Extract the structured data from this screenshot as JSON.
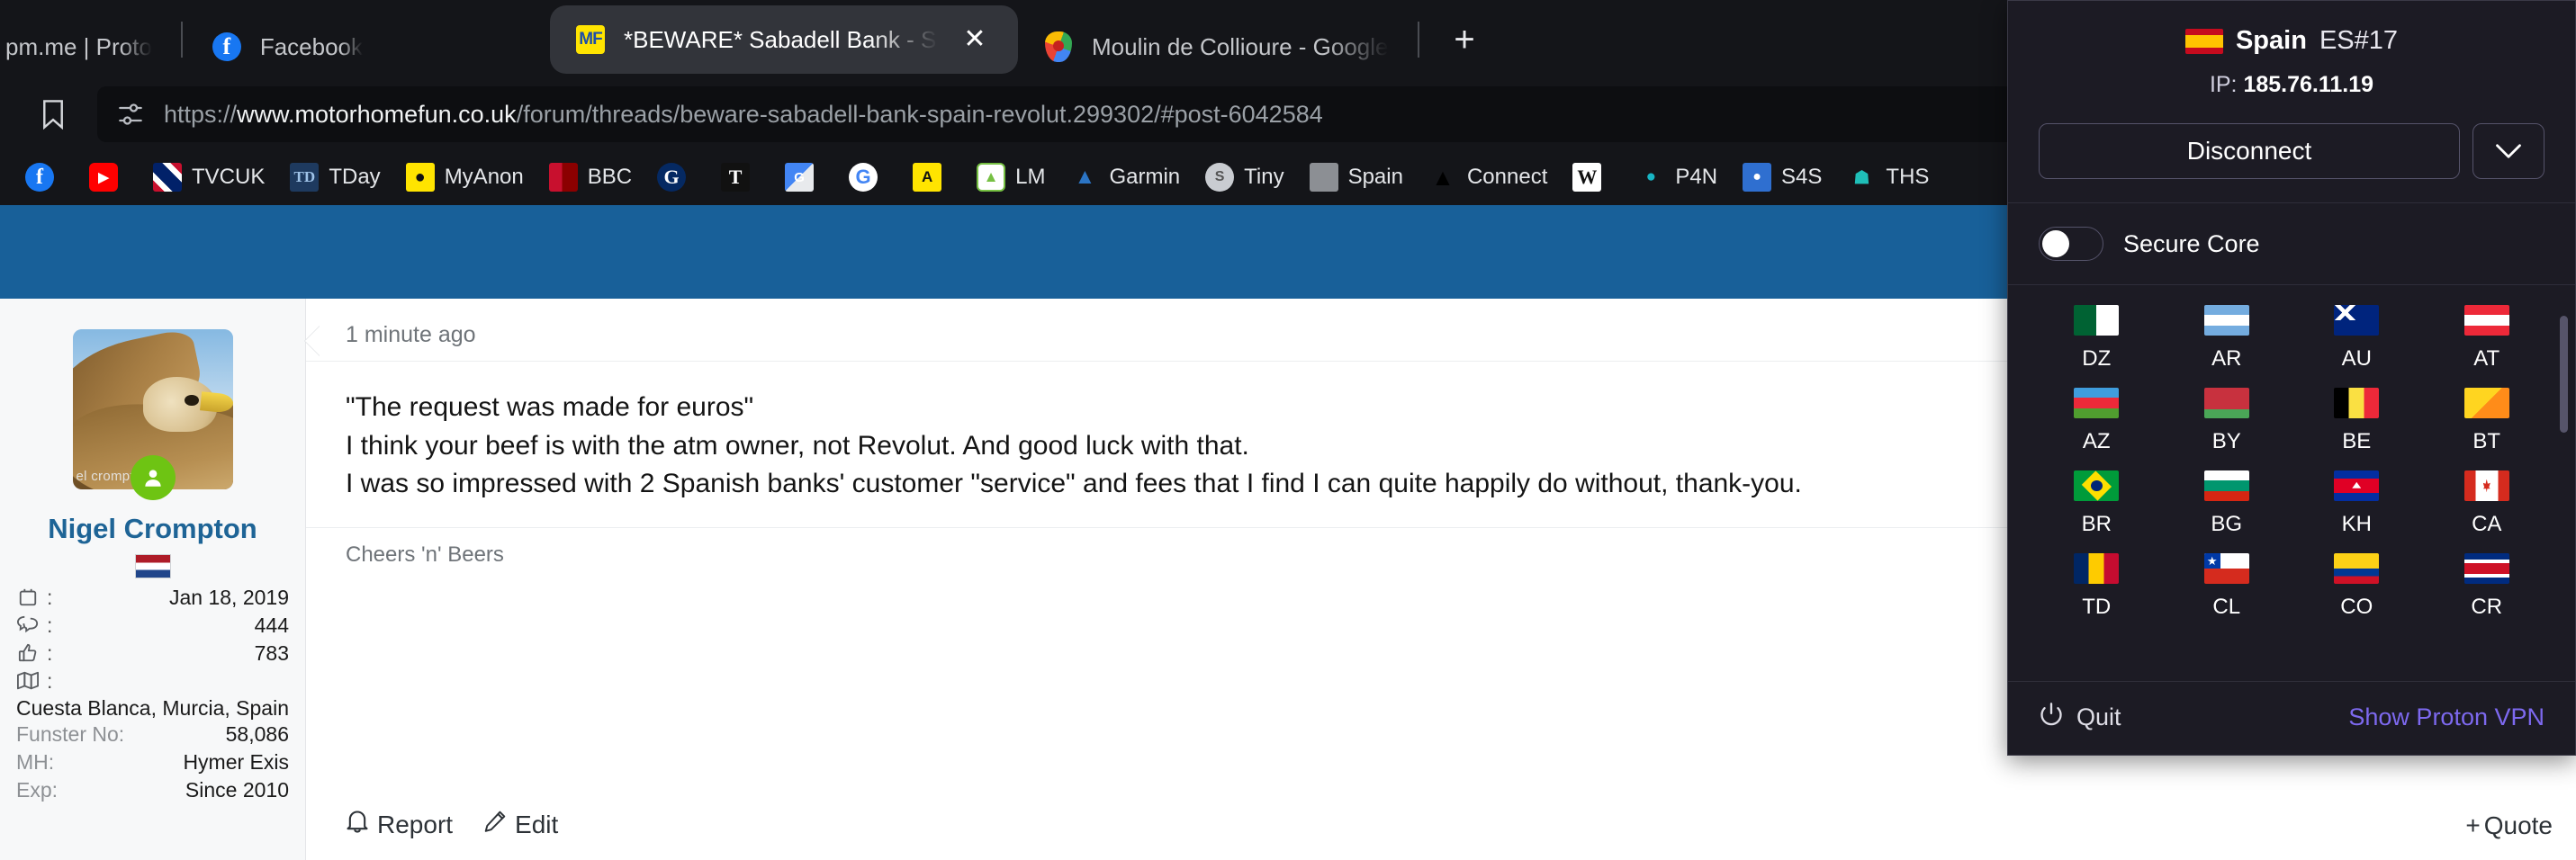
{
  "browser": {
    "tabs": [
      {
        "title": "pm.me | Proto",
        "favicon": "none",
        "active": false,
        "truncated": true
      },
      {
        "title": "Facebook",
        "favicon": "facebook-icon",
        "active": false
      },
      {
        "title": "*BEWARE* Sabadell Bank - Sp",
        "favicon": "motorhomefun-icon",
        "active": true,
        "close_label": "✕"
      },
      {
        "title": "Moulin de Collioure - Google Maps",
        "favicon": "google-maps-icon",
        "active": false
      }
    ],
    "new_tab_label": "+",
    "omnibox": {
      "url_scheme": "https://",
      "url_host": "www.motorhomefun.co.uk",
      "url_path": "/forum/threads/beware-sabadell-bank-spain-revolut.299302/#post-6042584",
      "site_info_icon": "tune-icon",
      "bookmark_icon": "bookmark-icon"
    },
    "toolbar_icons": [
      {
        "name": "save-to-device-icon"
      },
      {
        "name": "zoom-out-icon"
      },
      {
        "name": "share-icon"
      },
      {
        "name": "brave-shields-extension-icon"
      }
    ],
    "bookmarks": [
      {
        "label": "",
        "icon": "facebook-icon"
      },
      {
        "label": "",
        "icon": "youtube-icon"
      },
      {
        "label": "TVCUK",
        "icon": "union-jack-icon"
      },
      {
        "label": "TDay",
        "icon": "tday-icon"
      },
      {
        "label": "MyAnon",
        "icon": "myanon-icon"
      },
      {
        "label": "BBC",
        "icon": "bbc-icon"
      },
      {
        "label": "",
        "icon": "guardian-icon"
      },
      {
        "label": "",
        "icon": "times-icon"
      },
      {
        "label": "",
        "icon": "google-translate-icon"
      },
      {
        "label": "",
        "icon": "google-icon"
      },
      {
        "label": "",
        "icon": "aa-icon"
      },
      {
        "label": "LM",
        "icon": "leaf-green-icon"
      },
      {
        "label": "Garmin",
        "icon": "garmin-icon"
      },
      {
        "label": "Tiny",
        "icon": "tiny-icon"
      },
      {
        "label": "Spain",
        "icon": "spain-folder-icon"
      },
      {
        "label": "Connect",
        "icon": "connect-icon"
      },
      {
        "label": "",
        "icon": "wikipedia-icon"
      },
      {
        "label": "P4N",
        "icon": "park4night-icon"
      },
      {
        "label": "S4S",
        "icon": "searchforsites-icon"
      },
      {
        "label": "THS",
        "icon": "ths-icon"
      }
    ]
  },
  "post": {
    "timestamp": "1 minute ago",
    "lines": [
      "\"The request was made for euros\"",
      "I think your beef is with the atm owner, not Revolut. And good luck with that.",
      "I was so impressed with 2 Spanish banks' customer \"service\" and fees that I find I can quite happily do without, thank-you."
    ],
    "signature": "Cheers 'n' Beers",
    "actions": [
      {
        "label": "Report",
        "icon": "bell-icon"
      },
      {
        "label": "Edit",
        "icon": "pencil-icon"
      }
    ],
    "quote_button": {
      "label": "Quote",
      "icon": "plus-icon"
    }
  },
  "author": {
    "name": "Nigel Crompton",
    "flag": "netherlands-flag-icon",
    "avatar_watermark": "el crompton",
    "online_status": "online",
    "stats": [
      {
        "icon": "calendar-icon",
        "label": "",
        "value": "Jan 18, 2019"
      },
      {
        "icon": "messages-icon",
        "label": "",
        "value": "444"
      },
      {
        "icon": "thumbs-up-icon",
        "label": "",
        "value": "783"
      },
      {
        "icon": "map-icon",
        "label": "",
        "value": ""
      }
    ],
    "location": "Cuesta Blanca, Murcia, Spain",
    "fields": [
      {
        "label": "Funster No:",
        "value": "58,086"
      },
      {
        "label": "MH:",
        "value": "Hymer Exis"
      },
      {
        "label": "Exp:",
        "value": "Since 2010"
      }
    ]
  },
  "vpn": {
    "country_name": "Spain",
    "server": "ES#17",
    "flag": "spain-flag-icon",
    "ip_label": "IP:",
    "ip_value": "185.76.11.19",
    "disconnect_label": "Disconnect",
    "chevron_icon": "chevron-down-icon",
    "secure_core_label": "Secure Core",
    "secure_core_enabled": false,
    "countries": [
      {
        "code": "DZ",
        "flag": "algeria"
      },
      {
        "code": "AR",
        "flag": "argentina"
      },
      {
        "code": "AU",
        "flag": "australia"
      },
      {
        "code": "AT",
        "flag": "austria"
      },
      {
        "code": "AZ",
        "flag": "azerbaijan"
      },
      {
        "code": "BY",
        "flag": "belarus"
      },
      {
        "code": "BE",
        "flag": "belgium"
      },
      {
        "code": "BT",
        "flag": "bhutan"
      },
      {
        "code": "BR",
        "flag": "brazil"
      },
      {
        "code": "BG",
        "flag": "bulgaria"
      },
      {
        "code": "KH",
        "flag": "cambodia"
      },
      {
        "code": "CA",
        "flag": "canada"
      },
      {
        "code": "TD",
        "flag": "chad"
      },
      {
        "code": "CL",
        "flag": "chile"
      },
      {
        "code": "CO",
        "flag": "colombia"
      },
      {
        "code": "CR",
        "flag": "costarica"
      }
    ],
    "quit_label": "Quit",
    "quit_icon": "power-icon",
    "show_app_label": "Show Proton VPN",
    "accent_color": "#7d69ef"
  },
  "colors": {
    "chrome_bg": "#141519",
    "omnibox_bg": "#0d0e11",
    "active_tab_bg": "#32343a",
    "page_banner": "#186099",
    "author_link": "#1e6496",
    "vpn_panel_bg": "#1c1b24"
  }
}
